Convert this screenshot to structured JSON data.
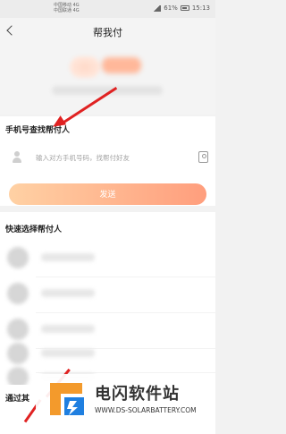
{
  "status_bar": {
    "carrier_line_1": "中国移动 4G",
    "carrier_line_2": "中国联通 4G",
    "battery": "61%",
    "time": "15:13"
  },
  "nav": {
    "title": "帮我付"
  },
  "phone_search": {
    "section_title": "手机号查找帮付人",
    "placeholder": "输入对方手机号码，找帮付好友",
    "send_label": "发送"
  },
  "quick_select": {
    "section_title": "快速选择帮付人",
    "contacts": [
      {},
      {},
      {},
      {},
      {}
    ]
  },
  "bottom_section": {
    "title": "通过其"
  },
  "watermark": {
    "brand": "电闪软件站",
    "url": "WWW.DS-SOLARBATTERY.COM"
  },
  "colors": {
    "accent": "#ff9e7d",
    "annotation_arrow": "#e02222",
    "logo_orange": "#f39a2c",
    "logo_blue": "#1f7fe0"
  }
}
